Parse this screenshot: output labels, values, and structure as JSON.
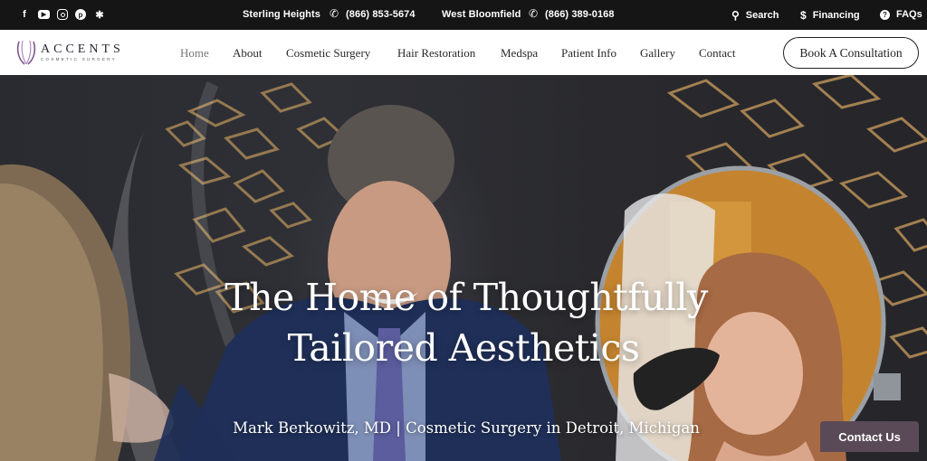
{
  "topbar": {
    "social_icons": [
      "facebook-icon",
      "youtube-icon",
      "instagram-icon",
      "pinterest-icon",
      "yelp-icon"
    ],
    "locations": [
      {
        "name": "Sterling Heights",
        "phone": "(866) 853-5674"
      },
      {
        "name": "West Bloomfield",
        "phone": "(866) 389-0168"
      }
    ],
    "search_label": "Search",
    "financing_label": "Financing",
    "faqs_label": "FAQs"
  },
  "brand": {
    "name": "ACCENTS",
    "tagline": "COSMETIC SURGERY",
    "accent_color": "#6b4a78"
  },
  "nav": {
    "items": [
      {
        "label": "Home",
        "active": true
      },
      {
        "label": "About"
      },
      {
        "label": "Cosmetic Surgery"
      },
      {
        "label": "Hair Restoration"
      },
      {
        "label": "Medspa"
      },
      {
        "label": "Patient Info"
      },
      {
        "label": "Gallery"
      },
      {
        "label": "Contact"
      }
    ],
    "cta_label": "Book A Consultation"
  },
  "hero": {
    "title_line1": "The Home of Thoughtfully",
    "title_line2": "Tailored Aesthetics",
    "subtitle": "Mark Berkowitz, MD | Cosmetic Surgery in Detroit, Michigan"
  },
  "floating": {
    "contact_label": "Contact Us",
    "contact_color": "#5a4a57"
  }
}
